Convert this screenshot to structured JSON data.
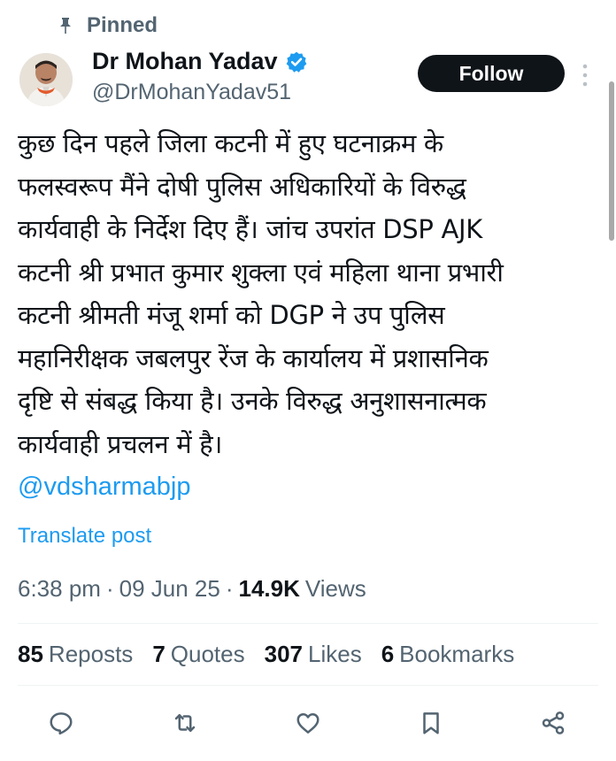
{
  "pinned": {
    "label": "Pinned",
    "icon": "pin-icon"
  },
  "author": {
    "display_name": "Dr Mohan Yadav",
    "handle": "@DrMohanYadav51",
    "verified_icon": "verified-badge-icon",
    "verified_color": "#1d9bf0"
  },
  "follow_label": "Follow",
  "post": {
    "text": "कुछ दिन पहले जिला कटनी में हुए घटनाक्रम के\nफलस्वरूप मैंने दोषी पुलिस अधिकारियों के विरुद्ध\nकार्यवाही के निर्देश दिए हैं। जांच उपरांत DSP AJK\nकटनी श्री प्रभात कुमार शुक्ला एवं महिला थाना प्रभारी\nकटनी श्रीमती मंजू शर्मा को DGP ने उप पुलिस\nमहानिरीक्षक जबलपुर रेंज के कार्यालय में प्रशासनिक\nदृष्टि से संबद्ध किया है। उनके विरुद्ध अनुशासनात्मक\nकार्यवाही प्रचलन में है।",
    "mention": "@vdsharmabjp",
    "translate_label": "Translate post"
  },
  "meta": {
    "time": "6:38 pm",
    "date": "09 Jun 25",
    "views_count": "14.9K",
    "views_label": "Views",
    "separator": "·"
  },
  "stats": [
    {
      "count": "85",
      "label": "Reposts"
    },
    {
      "count": "7",
      "label": "Quotes"
    },
    {
      "count": "307",
      "label": "Likes"
    },
    {
      "count": "6",
      "label": "Bookmarks"
    }
  ],
  "actions": [
    "reply-icon",
    "repost-icon",
    "like-icon",
    "bookmark-icon",
    "share-icon"
  ],
  "colors": {
    "accent": "#1d9bf0",
    "text": "#0f1419",
    "secondary": "#536471",
    "button": "#0f1419"
  }
}
